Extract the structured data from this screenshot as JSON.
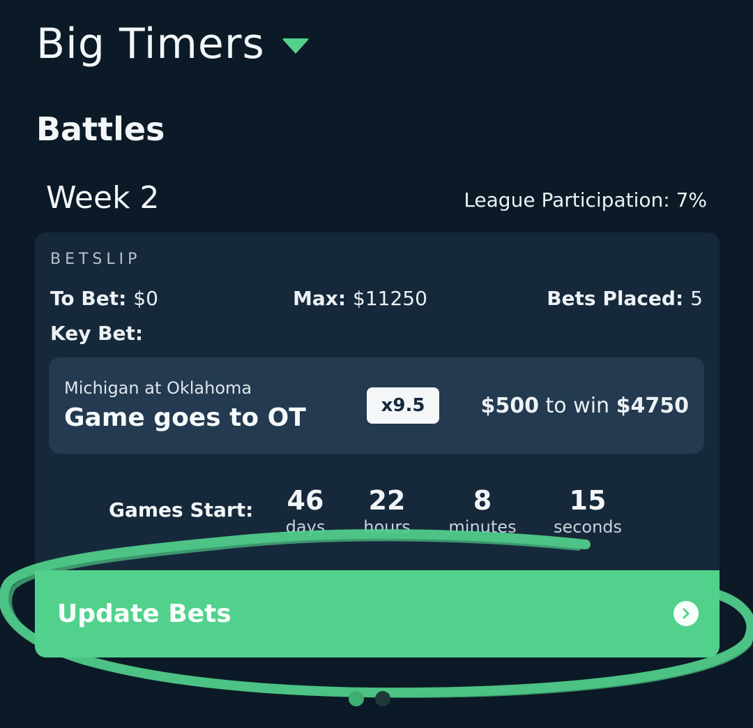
{
  "header": {
    "league_name": "Big Timers"
  },
  "section": {
    "title": "Battles"
  },
  "week": {
    "title": "Week 2",
    "participation": "League Participation: 7%"
  },
  "betslip": {
    "label": "BETSLIP",
    "to_bet_label": "To Bet:",
    "to_bet_value": "$0",
    "max_label": "Max:",
    "max_value": "$11250",
    "bets_placed_label": "Bets Placed:",
    "bets_placed_value": "5",
    "key_bet_label": "Key Bet:",
    "key_bet": {
      "matchup": "Michigan at Oklahoma",
      "description": "Game goes to OT",
      "odds": "x9.5",
      "stake": "$500",
      "to_win_text": "to win",
      "payout": "$4750"
    }
  },
  "countdown": {
    "label": "Games Start:",
    "units": [
      {
        "value": "46",
        "label": "days"
      },
      {
        "value": "22",
        "label": "hours"
      },
      {
        "value": "8",
        "label": "minutes"
      },
      {
        "value": "15",
        "label": "seconds"
      }
    ]
  },
  "actions": {
    "update_label": "Update Bets"
  },
  "pagination": {
    "pages": 2,
    "current": 1
  },
  "colors": {
    "background": "#0b1a26",
    "card": "#16293b",
    "accent": "#52d18c"
  },
  "icons": {
    "dropdown": "caret-down-icon",
    "button_arrow": "chevron-right-icon"
  }
}
